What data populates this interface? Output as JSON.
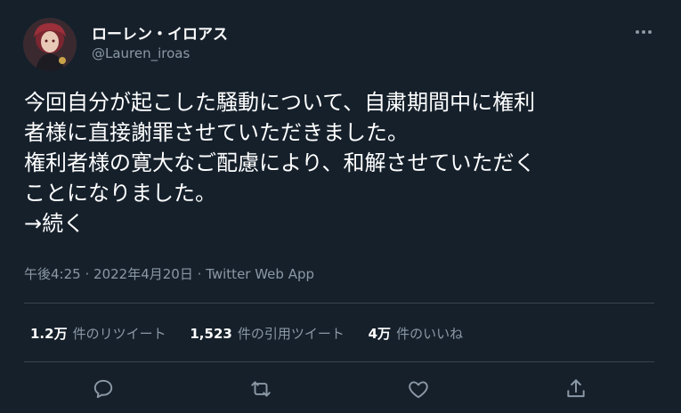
{
  "author": {
    "display_name": "ローレン・イロアス",
    "handle": "@Lauren_iroas",
    "avatar_icon": "user-avatar"
  },
  "more_icon": "more-horizontal-icon",
  "tweet": {
    "lines": [
      "今回自分が起こした騒動について、自粛期間中に権利",
      "者様に直接謝罪させていただきました。",
      "権利者様の寛大なご配慮により、和解させていただく",
      "ことになりました。",
      "→続く"
    ]
  },
  "meta": {
    "time": "午後4:25",
    "separator": "·",
    "date": "2022年4月20日",
    "client": "Twitter Web App"
  },
  "stats": {
    "retweets": {
      "count": "1.2万",
      "label": "件のリツイート"
    },
    "quotes": {
      "count": "1,523",
      "label": "件の引用ツイート"
    },
    "likes": {
      "count": "4万",
      "label": "件のいいね"
    }
  },
  "actions": [
    {
      "icon": "reply-icon"
    },
    {
      "icon": "retweet-icon"
    },
    {
      "icon": "like-icon"
    },
    {
      "icon": "share-icon"
    }
  ],
  "colors": {
    "background": "#15202b",
    "text": "#ffffff",
    "secondary_text": "#8b98a5",
    "divider": "#38444d"
  }
}
